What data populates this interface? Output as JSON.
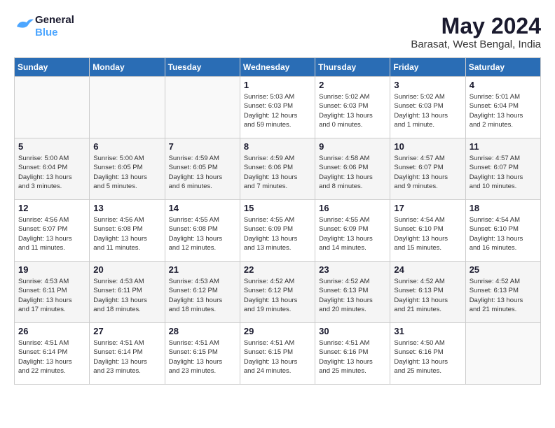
{
  "logo": {
    "line1": "General",
    "line2": "Blue"
  },
  "title": "May 2024",
  "location": "Barasat, West Bengal, India",
  "weekdays": [
    "Sunday",
    "Monday",
    "Tuesday",
    "Wednesday",
    "Thursday",
    "Friday",
    "Saturday"
  ],
  "weeks": [
    [
      {
        "num": "",
        "info": ""
      },
      {
        "num": "",
        "info": ""
      },
      {
        "num": "",
        "info": ""
      },
      {
        "num": "1",
        "info": "Sunrise: 5:03 AM\nSunset: 6:03 PM\nDaylight: 12 hours\nand 59 minutes."
      },
      {
        "num": "2",
        "info": "Sunrise: 5:02 AM\nSunset: 6:03 PM\nDaylight: 13 hours\nand 0 minutes."
      },
      {
        "num": "3",
        "info": "Sunrise: 5:02 AM\nSunset: 6:03 PM\nDaylight: 13 hours\nand 1 minute."
      },
      {
        "num": "4",
        "info": "Sunrise: 5:01 AM\nSunset: 6:04 PM\nDaylight: 13 hours\nand 2 minutes."
      }
    ],
    [
      {
        "num": "5",
        "info": "Sunrise: 5:00 AM\nSunset: 6:04 PM\nDaylight: 13 hours\nand 3 minutes."
      },
      {
        "num": "6",
        "info": "Sunrise: 5:00 AM\nSunset: 6:05 PM\nDaylight: 13 hours\nand 5 minutes."
      },
      {
        "num": "7",
        "info": "Sunrise: 4:59 AM\nSunset: 6:05 PM\nDaylight: 13 hours\nand 6 minutes."
      },
      {
        "num": "8",
        "info": "Sunrise: 4:59 AM\nSunset: 6:06 PM\nDaylight: 13 hours\nand 7 minutes."
      },
      {
        "num": "9",
        "info": "Sunrise: 4:58 AM\nSunset: 6:06 PM\nDaylight: 13 hours\nand 8 minutes."
      },
      {
        "num": "10",
        "info": "Sunrise: 4:57 AM\nSunset: 6:07 PM\nDaylight: 13 hours\nand 9 minutes."
      },
      {
        "num": "11",
        "info": "Sunrise: 4:57 AM\nSunset: 6:07 PM\nDaylight: 13 hours\nand 10 minutes."
      }
    ],
    [
      {
        "num": "12",
        "info": "Sunrise: 4:56 AM\nSunset: 6:07 PM\nDaylight: 13 hours\nand 11 minutes."
      },
      {
        "num": "13",
        "info": "Sunrise: 4:56 AM\nSunset: 6:08 PM\nDaylight: 13 hours\nand 11 minutes."
      },
      {
        "num": "14",
        "info": "Sunrise: 4:55 AM\nSunset: 6:08 PM\nDaylight: 13 hours\nand 12 minutes."
      },
      {
        "num": "15",
        "info": "Sunrise: 4:55 AM\nSunset: 6:09 PM\nDaylight: 13 hours\nand 13 minutes."
      },
      {
        "num": "16",
        "info": "Sunrise: 4:55 AM\nSunset: 6:09 PM\nDaylight: 13 hours\nand 14 minutes."
      },
      {
        "num": "17",
        "info": "Sunrise: 4:54 AM\nSunset: 6:10 PM\nDaylight: 13 hours\nand 15 minutes."
      },
      {
        "num": "18",
        "info": "Sunrise: 4:54 AM\nSunset: 6:10 PM\nDaylight: 13 hours\nand 16 minutes."
      }
    ],
    [
      {
        "num": "19",
        "info": "Sunrise: 4:53 AM\nSunset: 6:11 PM\nDaylight: 13 hours\nand 17 minutes."
      },
      {
        "num": "20",
        "info": "Sunrise: 4:53 AM\nSunset: 6:11 PM\nDaylight: 13 hours\nand 18 minutes."
      },
      {
        "num": "21",
        "info": "Sunrise: 4:53 AM\nSunset: 6:12 PM\nDaylight: 13 hours\nand 18 minutes."
      },
      {
        "num": "22",
        "info": "Sunrise: 4:52 AM\nSunset: 6:12 PM\nDaylight: 13 hours\nand 19 minutes."
      },
      {
        "num": "23",
        "info": "Sunrise: 4:52 AM\nSunset: 6:13 PM\nDaylight: 13 hours\nand 20 minutes."
      },
      {
        "num": "24",
        "info": "Sunrise: 4:52 AM\nSunset: 6:13 PM\nDaylight: 13 hours\nand 21 minutes."
      },
      {
        "num": "25",
        "info": "Sunrise: 4:52 AM\nSunset: 6:13 PM\nDaylight: 13 hours\nand 21 minutes."
      }
    ],
    [
      {
        "num": "26",
        "info": "Sunrise: 4:51 AM\nSunset: 6:14 PM\nDaylight: 13 hours\nand 22 minutes."
      },
      {
        "num": "27",
        "info": "Sunrise: 4:51 AM\nSunset: 6:14 PM\nDaylight: 13 hours\nand 23 minutes."
      },
      {
        "num": "28",
        "info": "Sunrise: 4:51 AM\nSunset: 6:15 PM\nDaylight: 13 hours\nand 23 minutes."
      },
      {
        "num": "29",
        "info": "Sunrise: 4:51 AM\nSunset: 6:15 PM\nDaylight: 13 hours\nand 24 minutes."
      },
      {
        "num": "30",
        "info": "Sunrise: 4:51 AM\nSunset: 6:16 PM\nDaylight: 13 hours\nand 25 minutes."
      },
      {
        "num": "31",
        "info": "Sunrise: 4:50 AM\nSunset: 6:16 PM\nDaylight: 13 hours\nand 25 minutes."
      },
      {
        "num": "",
        "info": ""
      }
    ]
  ]
}
